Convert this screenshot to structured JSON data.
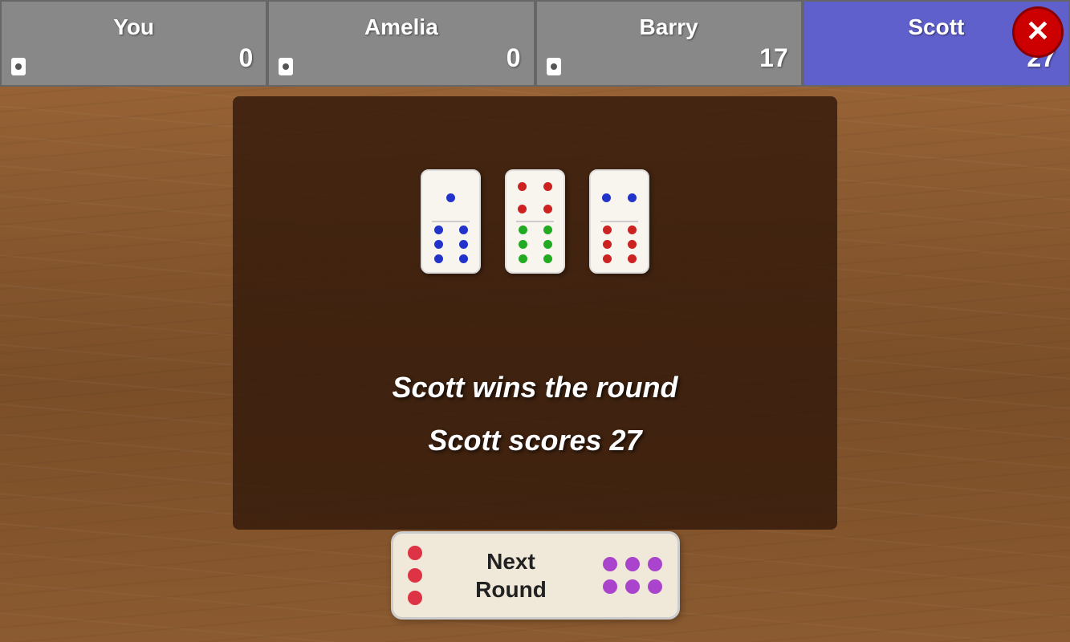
{
  "header": {
    "players": [
      {
        "id": "you",
        "name": "You",
        "score": "0",
        "active": false
      },
      {
        "id": "amelia",
        "name": "Amelia",
        "score": "0",
        "active": false
      },
      {
        "id": "barry",
        "name": "Barry",
        "score": "17",
        "active": false
      },
      {
        "id": "scott",
        "name": "Scott",
        "score": "27",
        "active": true
      }
    ]
  },
  "main": {
    "win_message": "Scott wins the round",
    "score_message": "Scott scores 27"
  },
  "button": {
    "label_line1": "Next",
    "label_line2": "Round"
  }
}
